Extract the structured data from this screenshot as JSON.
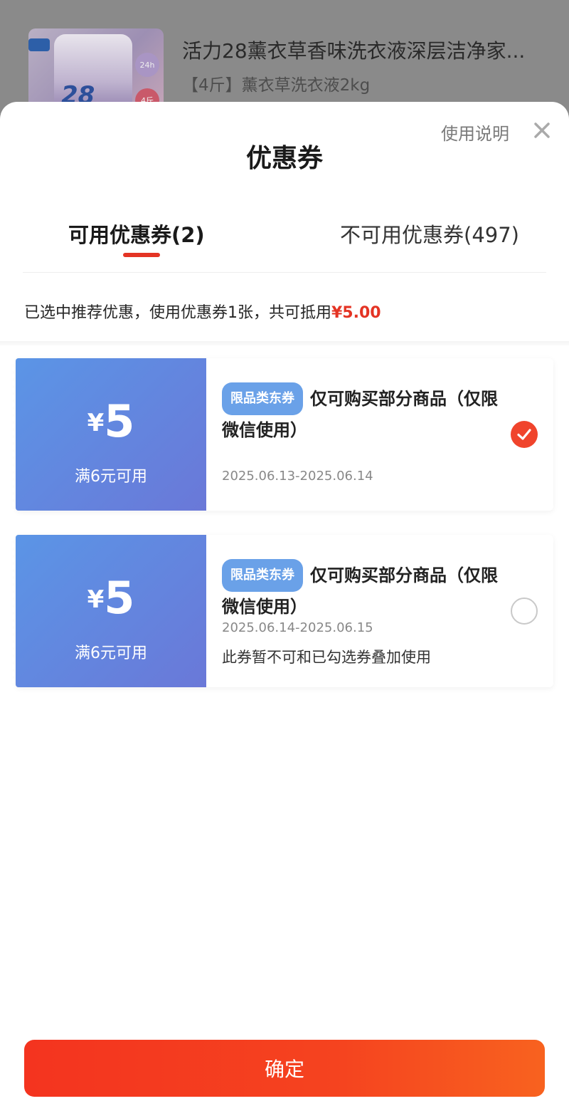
{
  "product": {
    "title": "活力28薰衣草香味洗衣液深层洁净家...",
    "spec": "【4斤】薰衣草洗衣液2kg",
    "image_icon": "laundry-detergent-image"
  },
  "sheet": {
    "title": "优惠券",
    "usage_link": "使用说明",
    "close_icon": "close-icon"
  },
  "tabs": [
    {
      "label": "可用优惠券(2)",
      "active": true
    },
    {
      "label": "不可用优惠券(497)",
      "active": false
    }
  ],
  "summary": {
    "prefix": "已选中推荐优惠，使用优惠券1张，共可抵用",
    "amount": "¥5.00"
  },
  "coupons": [
    {
      "currency": "¥",
      "value": "5",
      "condition": "满6元可用",
      "tag": "限品类东券",
      "description": "仅可购买部分商品（仅限微信使用）",
      "date": "2025.06.13-2025.06.14",
      "note": "",
      "selected": true
    },
    {
      "currency": "¥",
      "value": "5",
      "condition": "满6元可用",
      "tag": "限品类东券",
      "description": "仅可购买部分商品（仅限微信使用）",
      "date": "2025.06.14-2025.06.15",
      "note": "此券暂不可和已勾选券叠加使用",
      "selected": false
    }
  ],
  "confirm": {
    "label": "确定"
  },
  "colors": {
    "accent": "#e43424",
    "coupon_gradient_start": "#5b95e6",
    "coupon_gradient_end": "#6a78d8",
    "tag_bg": "#6aa1e8"
  }
}
